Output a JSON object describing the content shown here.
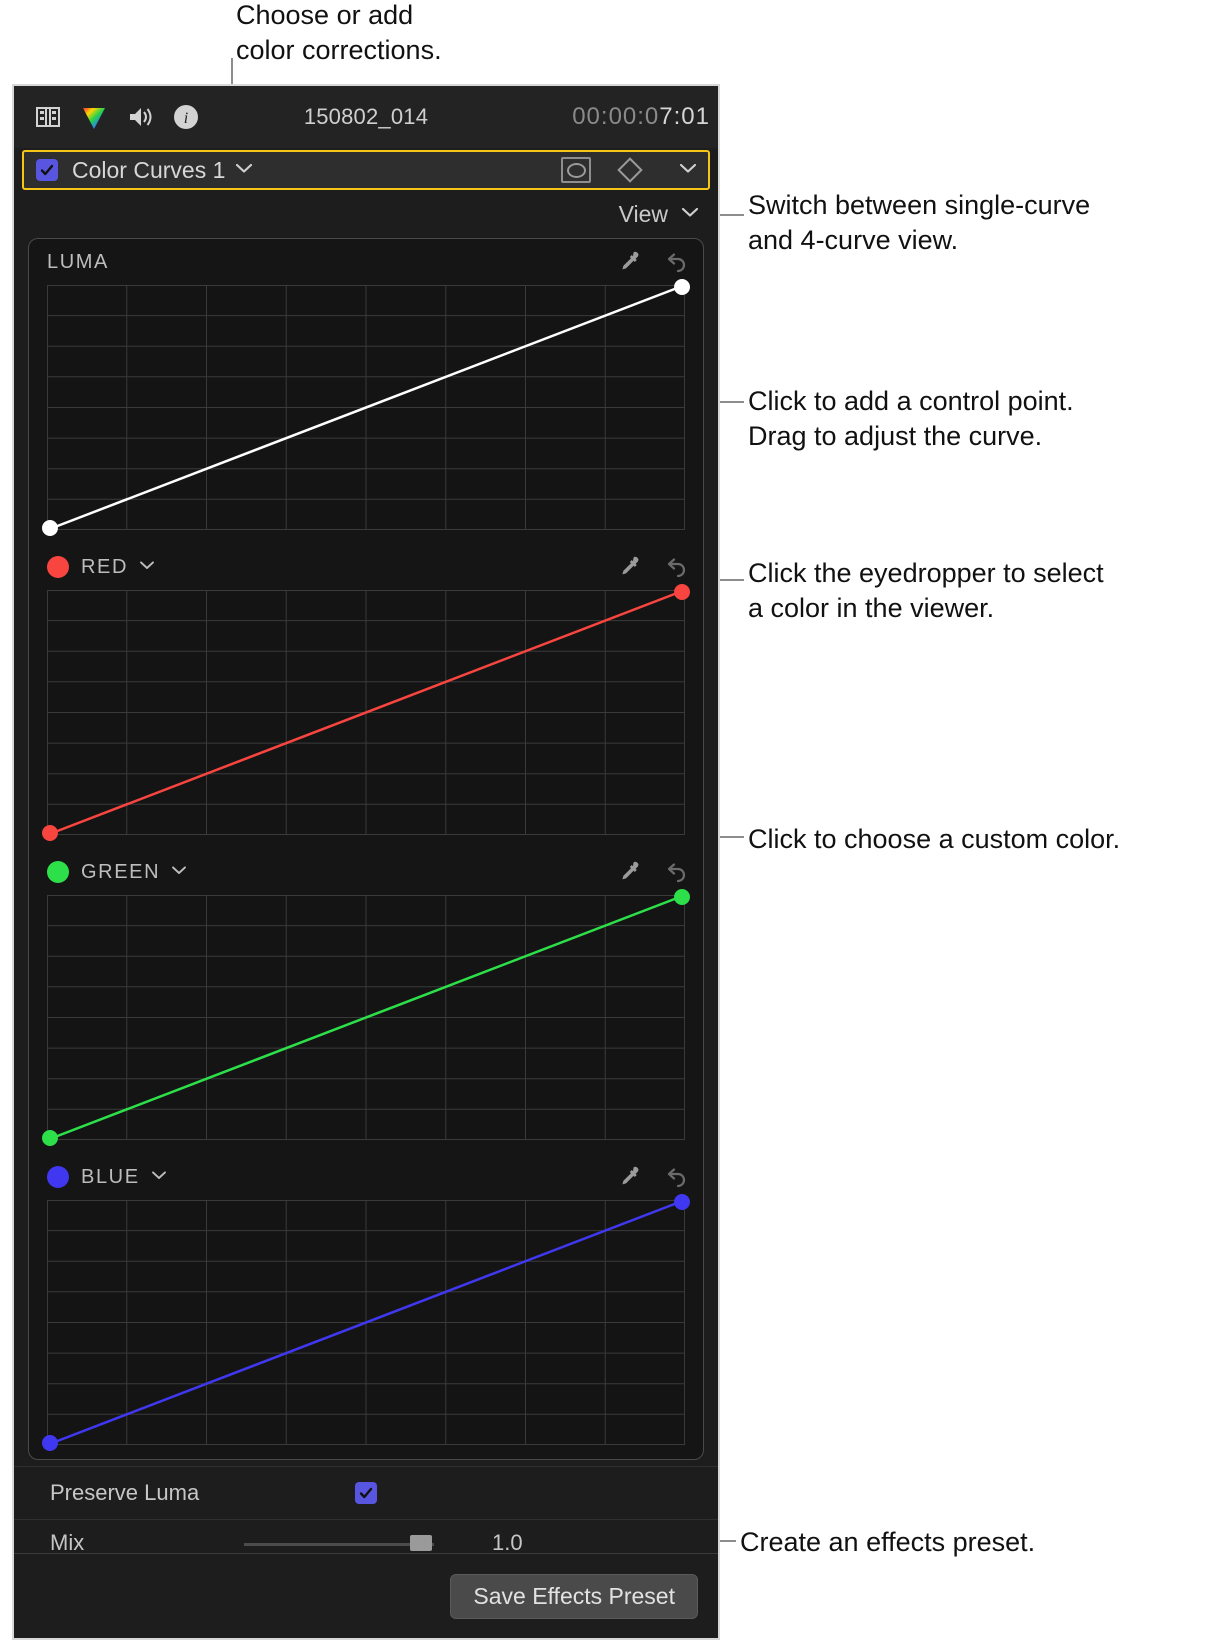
{
  "annotations": [
    {
      "id": "choose-add",
      "text": "Choose or add\ncolor corrections."
    },
    {
      "id": "switch-view",
      "text": "Switch between single-curve\nand 4-curve view."
    },
    {
      "id": "add-control-point",
      "text": "Click to add a control point.\nDrag to adjust the curve."
    },
    {
      "id": "eyedropper",
      "text": "Click the eyedropper to select\na color in the viewer."
    },
    {
      "id": "custom-color",
      "text": "Click to choose a custom color."
    },
    {
      "id": "save-preset",
      "text": "Create an effects preset."
    }
  ],
  "inspector": {
    "clip_title": "150802_014",
    "timecode": "00:00:07:01",
    "timecode_dim": "00:00:0",
    "timecode_bright": "7:01",
    "icons": [
      "film-strip-icon",
      "color-wheel-icon",
      "audio-speaker-icon",
      "info-icon"
    ]
  },
  "effect": {
    "enabled": true,
    "name": "Color Curves 1",
    "mask_button": "mask-button",
    "keyframe_button": "keyframe-diamond-button"
  },
  "view": {
    "label": "View"
  },
  "curves": [
    {
      "id": "luma",
      "label": "LUMA",
      "color": "#ffffff",
      "has_swatch": false,
      "has_chevron": false,
      "eyedropper": "eyedropper-icon",
      "reset": "reset-icon"
    },
    {
      "id": "red",
      "label": "RED",
      "color": "#f8453f",
      "has_swatch": true,
      "has_chevron": true,
      "eyedropper": "eyedropper-icon",
      "reset": "reset-icon"
    },
    {
      "id": "green",
      "label": "GREEN",
      "color": "#2de04a",
      "has_swatch": true,
      "has_chevron": true,
      "eyedropper": "eyedropper-icon",
      "reset": "reset-icon"
    },
    {
      "id": "blue",
      "label": "BLUE",
      "color": "#4038f0",
      "has_swatch": true,
      "has_chevron": true,
      "eyedropper": "eyedropper-icon",
      "reset": "reset-icon"
    }
  ],
  "chart_data": {
    "type": "line",
    "title": "Color Curves",
    "grid": true,
    "xlim": [
      0,
      1
    ],
    "ylim": [
      0,
      1
    ],
    "xlabel": "",
    "ylabel": "",
    "grid_columns": 8,
    "grid_rows": 8,
    "series": [
      {
        "name": "LUMA",
        "color": "#ffffff",
        "x": [
          0,
          1
        ],
        "y": [
          0,
          1
        ],
        "control_points": [
          [
            0,
            0
          ],
          [
            1,
            1
          ]
        ]
      },
      {
        "name": "RED",
        "color": "#f8453f",
        "x": [
          0,
          1
        ],
        "y": [
          0,
          1
        ],
        "control_points": [
          [
            0,
            0
          ],
          [
            1,
            1
          ]
        ]
      },
      {
        "name": "GREEN",
        "color": "#2de04a",
        "x": [
          0,
          1
        ],
        "y": [
          0,
          1
        ],
        "control_points": [
          [
            0,
            0
          ],
          [
            1,
            1
          ]
        ]
      },
      {
        "name": "BLUE",
        "color": "#4038f0",
        "x": [
          0,
          1
        ],
        "y": [
          0,
          1
        ],
        "control_points": [
          [
            0,
            0
          ],
          [
            1,
            1
          ]
        ]
      }
    ]
  },
  "params": {
    "preserve_luma_label": "Preserve Luma",
    "preserve_luma_checked": true,
    "mix_label": "Mix",
    "mix_value": "1.0"
  },
  "bottom": {
    "save_preset_label": "Save Effects Preset"
  },
  "colors": {
    "selection": "#f5c518",
    "checkbox": "#5856e0",
    "panel_bg": "#1d1d1d",
    "graph_bg": "#151515"
  }
}
